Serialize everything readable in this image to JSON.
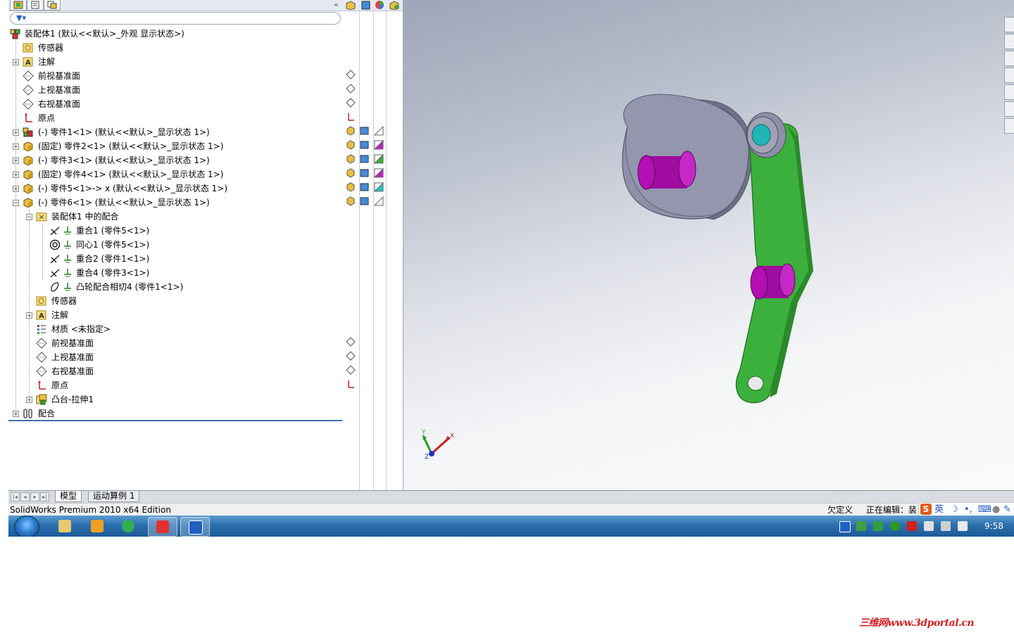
{
  "tree": {
    "root": "装配体1 (默认<<默认>_外观 显示状态>)",
    "items": [
      {
        "label": "传感器"
      },
      {
        "label": "注解"
      },
      {
        "label": "前视基准面"
      },
      {
        "label": "上视基准面"
      },
      {
        "label": "右视基准面"
      },
      {
        "label": "原点"
      },
      {
        "label": "(-) 零件1<1> (默认<<默认>_显示状态 1>)"
      },
      {
        "label": "(固定) 零件2<1> (默认<<默认>_显示状态 1>)"
      },
      {
        "label": "(-) 零件3<1> (默认<<默认>_显示状态 1>)"
      },
      {
        "label": "(固定) 零件4<1> (默认<<默认>_显示状态 1>)"
      },
      {
        "label": "(-) 零件5<1>-> x (默认<<默认>_显示状态 1>)"
      },
      {
        "label": "(-) 零件6<1> (默认<<默认>_显示状态 1>)"
      },
      {
        "label": "装配体1 中的配合"
      },
      {
        "label": "重合1 (零件5<1>)"
      },
      {
        "label": "同心1 (零件5<1>)"
      },
      {
        "label": "重合2 (零件1<1>)"
      },
      {
        "label": "重合4 (零件3<1>)"
      },
      {
        "label": "凸轮配合相切4 (零件1<1>)"
      },
      {
        "label": "传感器"
      },
      {
        "label": "注解"
      },
      {
        "label": "材质 <未指定>"
      },
      {
        "label": "前视基准面"
      },
      {
        "label": "上视基准面"
      },
      {
        "label": "右视基准面"
      },
      {
        "label": "原点"
      },
      {
        "label": "凸台-拉伸1"
      },
      {
        "label": "配合"
      }
    ]
  },
  "icons": {
    "fm_tabs": [
      "feature-manager-icon",
      "property-manager-icon",
      "configuration-manager-icon"
    ],
    "fm_tabs_right": [
      "display-manager-icon",
      "appearance-icon",
      "scene-icon",
      "dim-expert-icon"
    ],
    "taskpane": [
      "resources-icon",
      "design-library-icon",
      "file-explorer-icon",
      "search-icon",
      "view-palette-icon",
      "appearances-icon",
      "custom-properties-icon"
    ]
  },
  "triad": {
    "x": "X",
    "y": "Y",
    "z": "Z"
  },
  "bottom_tabs": {
    "model": "模型",
    "motion": "运动算例 1"
  },
  "status": {
    "edition": "SolidWorks Premium 2010 x64 Edition",
    "definition": "欠定义",
    "editing": "正在编辑：装",
    "ime_lang": "英"
  },
  "taskbar": {
    "clock": "9:58",
    "apps": [
      "file-explorer-icon",
      "media-player-icon",
      "app-icon",
      "solidworks-icon",
      "remote-icon"
    ]
  },
  "watermark": "三维网www.3dportal.cn",
  "colors": {
    "part_green": "#3cb03c",
    "pin_magenta": "#b30fb3",
    "cam_gray": "#8e90a8",
    "roller_cyan": "#1fb5b5",
    "taskbar_blue": "#2c6fad",
    "watermark_red": "#d42020"
  }
}
